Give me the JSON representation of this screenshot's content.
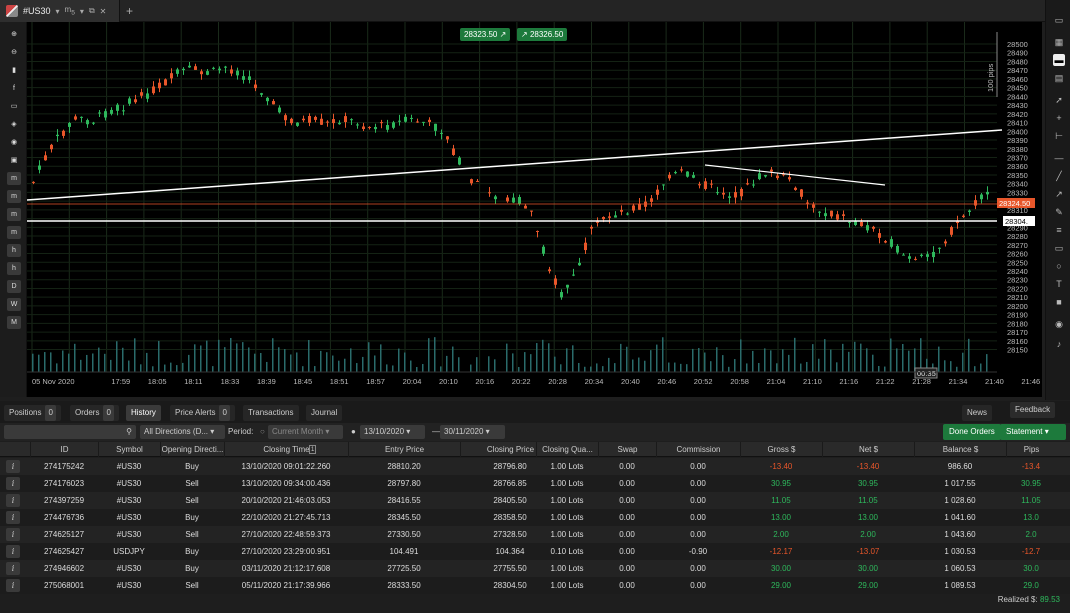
{
  "tab": {
    "symbol": "#US30",
    "timeframe": "m",
    "tf_sub": "5"
  },
  "chart": {
    "bid_box": "28323.50",
    "ask_box": "28326.50",
    "current_price_label": "28324.50",
    "line_price_label": "28304.",
    "pips_label": "100 pips",
    "countdown": "00:35",
    "price_ticks": [
      "28500",
      "28490",
      "28480",
      "28470",
      "28460",
      "28450",
      "28440",
      "28430",
      "28420",
      "28410",
      "28400",
      "28390",
      "28380",
      "28370",
      "28360",
      "28350",
      "28340",
      "28330",
      "28320",
      "28310",
      "28300",
      "28290",
      "28280",
      "28270",
      "28260",
      "28250",
      "28240",
      "28230",
      "28220",
      "28210",
      "28200",
      "28190",
      "28180",
      "28170",
      "28160",
      "28150"
    ],
    "time_ticks": [
      "05 Nov 2020",
      "17:59",
      "18:05",
      "18:11",
      "18:33",
      "18:39",
      "18:45",
      "18:51",
      "18:57",
      "20:04",
      "20:10",
      "20:16",
      "20:22",
      "20:28",
      "20:34",
      "20:40",
      "20:46",
      "20:52",
      "20:58",
      "21:04",
      "21:10",
      "21:16",
      "21:22",
      "21:28",
      "21:34",
      "21:40",
      "21:46"
    ]
  },
  "left_tools": [
    "search-plus",
    "search-minus",
    "bars",
    "facebook",
    "crosshair",
    "layers",
    "eye",
    "camera",
    "m1",
    "m5",
    "m15",
    "m30",
    "h1",
    "h4",
    "D",
    "W",
    "M"
  ],
  "left_tool_labels": {
    "m1": "m",
    "m5": "m",
    "m15": "m",
    "m30": "m",
    "h1": "h",
    "h4": "h",
    "D": "D",
    "W": "W",
    "M": "M"
  },
  "panel": {
    "tabs": [
      {
        "label": "Positions",
        "count": "0"
      },
      {
        "label": "Orders",
        "count": "0"
      },
      {
        "label": "History",
        "count": ""
      },
      {
        "label": "Price Alerts",
        "count": "0"
      },
      {
        "label": "Transactions",
        "count": ""
      },
      {
        "label": "Journal",
        "count": ""
      }
    ],
    "news_label": "News",
    "feedback_label": "Feedback",
    "filter": {
      "direction": "All Directions (D...",
      "period_label": "Period:",
      "current_month": "Current Month",
      "date_from": "13/10/2020",
      "date_to": "30/11/2020",
      "done_orders": "Done Orders",
      "statement": "Statement"
    },
    "columns": [
      "ID",
      "Symbol",
      "Opening Directi...",
      "Closing Time",
      "Entry Price",
      "Closing Price",
      "Closing Qua...",
      "Swap",
      "Commission",
      "Gross $",
      "Net $",
      "Balance $",
      "Pips"
    ],
    "sort_indicator": "1",
    "rows": [
      {
        "id": "274175242",
        "symbol": "#US30",
        "dir": "Buy",
        "time": "13/10/2020 09:01:22.260",
        "entry": "28810.20",
        "close": "28796.80",
        "qty": "1.00 Lots",
        "swap": "0.00",
        "comm": "0.00",
        "gross": "-13.40",
        "net": "-13.40",
        "bal": "986.60",
        "pips": "-13.4",
        "sign": "neg"
      },
      {
        "id": "274176023",
        "symbol": "#US30",
        "dir": "Sell",
        "time": "13/10/2020 09:34:00.436",
        "entry": "28797.80",
        "close": "28766.85",
        "qty": "1.00 Lots",
        "swap": "0.00",
        "comm": "0.00",
        "gross": "30.95",
        "net": "30.95",
        "bal": "1 017.55",
        "pips": "30.95",
        "sign": "pos"
      },
      {
        "id": "274397259",
        "symbol": "#US30",
        "dir": "Sell",
        "time": "20/10/2020 21:46:03.053",
        "entry": "28416.55",
        "close": "28405.50",
        "qty": "1.00 Lots",
        "swap": "0.00",
        "comm": "0.00",
        "gross": "11.05",
        "net": "11.05",
        "bal": "1 028.60",
        "pips": "11.05",
        "sign": "pos"
      },
      {
        "id": "274476736",
        "symbol": "#US30",
        "dir": "Buy",
        "time": "22/10/2020 21:27:45.713",
        "entry": "28345.50",
        "close": "28358.50",
        "qty": "1.00 Lots",
        "swap": "0.00",
        "comm": "0.00",
        "gross": "13.00",
        "net": "13.00",
        "bal": "1 041.60",
        "pips": "13.0",
        "sign": "pos"
      },
      {
        "id": "274625127",
        "symbol": "#US30",
        "dir": "Sell",
        "time": "27/10/2020 22:48:59.373",
        "entry": "27330.50",
        "close": "27328.50",
        "qty": "1.00 Lots",
        "swap": "0.00",
        "comm": "0.00",
        "gross": "2.00",
        "net": "2.00",
        "bal": "1 043.60",
        "pips": "2.0",
        "sign": "pos"
      },
      {
        "id": "274625427",
        "symbol": "USDJPY",
        "dir": "Buy",
        "time": "27/10/2020 23:29:00.951",
        "entry": "104.491",
        "close": "104.364",
        "qty": "0.10 Lots",
        "swap": "0.00",
        "comm": "-0.90",
        "gross": "-12.17",
        "net": "-13.07",
        "bal": "1 030.53",
        "pips": "-12.7",
        "sign": "neg"
      },
      {
        "id": "274946602",
        "symbol": "#US30",
        "dir": "Buy",
        "time": "03/11/2020 21:12:17.608",
        "entry": "27725.50",
        "close": "27755.50",
        "qty": "1.00 Lots",
        "swap": "0.00",
        "comm": "0.00",
        "gross": "30.00",
        "net": "30.00",
        "bal": "1 060.53",
        "pips": "30.0",
        "sign": "pos"
      },
      {
        "id": "275068001",
        "symbol": "#US30",
        "dir": "Sell",
        "time": "05/11/2020 21:17:39.966",
        "entry": "28333.50",
        "close": "28304.50",
        "qty": "1.00 Lots",
        "swap": "0.00",
        "comm": "0.00",
        "gross": "29.00",
        "net": "29.00",
        "bal": "1 089.53",
        "pips": "29.0",
        "sign": "pos"
      }
    ],
    "realized_label": "Realized $:",
    "realized_value": "89.53"
  }
}
